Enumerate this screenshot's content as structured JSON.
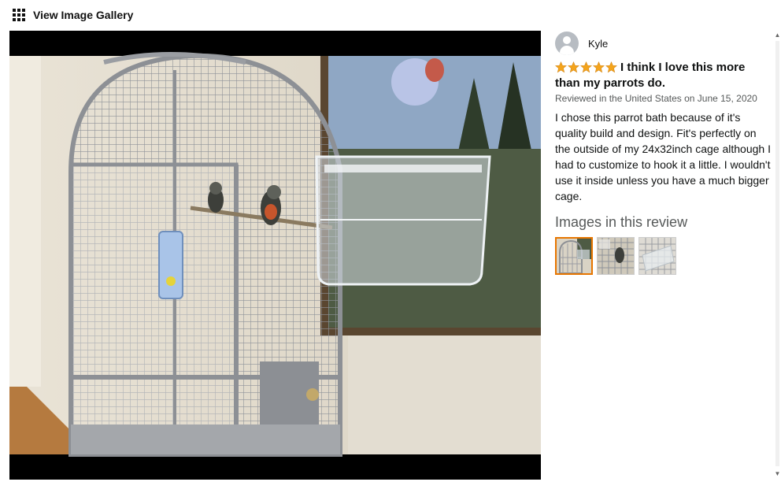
{
  "header": {
    "gallery_link": "View Image Gallery",
    "icon": "grid-icon"
  },
  "review": {
    "reviewer_name": "Kyle",
    "rating": 5,
    "rating_max": 5,
    "star_color": "#f4a41c",
    "title": "I think I love this more than my parrots do.",
    "meta": "Reviewed in the United States on June 15, 2020",
    "body": "I chose this parrot bath because of it's quality build and design. Fit's perfectly on the outside of my 24x32inch cage although I had to customize to hook it a little. I wouldn't use it inside unless you have a much bigger cage.",
    "images_header": "Images in this review",
    "thumbnail_count": 3,
    "selected_thumbnail": 1
  },
  "colors": {
    "selected_border": "#e77600",
    "viewer_background": "#000000",
    "meta_text": "#565959"
  }
}
